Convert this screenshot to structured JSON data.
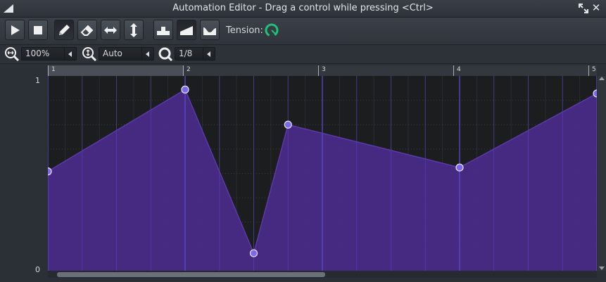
{
  "window": {
    "title": "Automation Editor - Drag a control while pressing <Ctrl>"
  },
  "toolbar": {
    "buttons": [
      {
        "name": "play-icon"
      },
      {
        "name": "stop-icon"
      },
      {
        "name": "pencil-icon",
        "active": true
      },
      {
        "name": "eraser-icon"
      },
      {
        "name": "horizontal-arrows-icon"
      },
      {
        "name": "vertical-arrows-icon"
      },
      {
        "name": "discrete-progression-icon"
      },
      {
        "name": "linear-progression-icon",
        "active": true
      },
      {
        "name": "cubic-progression-icon"
      }
    ],
    "tension_label": "Tension:",
    "tension_knob_color": "#1ec27a"
  },
  "zoom": {
    "horizontal": "100%",
    "vertical": "Auto",
    "quantization": "1/8"
  },
  "ruler": {
    "bars": [
      "1",
      "2",
      "3",
      "4",
      "5"
    ]
  },
  "y_axis": {
    "max_label": "1",
    "min_label": "0"
  },
  "chart_data": {
    "type": "area",
    "x": [
      1,
      2,
      2.5,
      2.75,
      4,
      5
    ],
    "y": [
      0.51,
      0.93,
      0.09,
      0.75,
      0.53,
      0.91
    ],
    "xlim": [
      1,
      5
    ],
    "ylim": [
      0,
      1
    ],
    "fill_color": "#4a2a8a",
    "point_color": "#7b68ee"
  },
  "colors": {
    "background": "#2b2f36",
    "grid_background": "#1b1d1f",
    "fill": "#4a2a8a",
    "grid_line": "#5b45c9"
  }
}
